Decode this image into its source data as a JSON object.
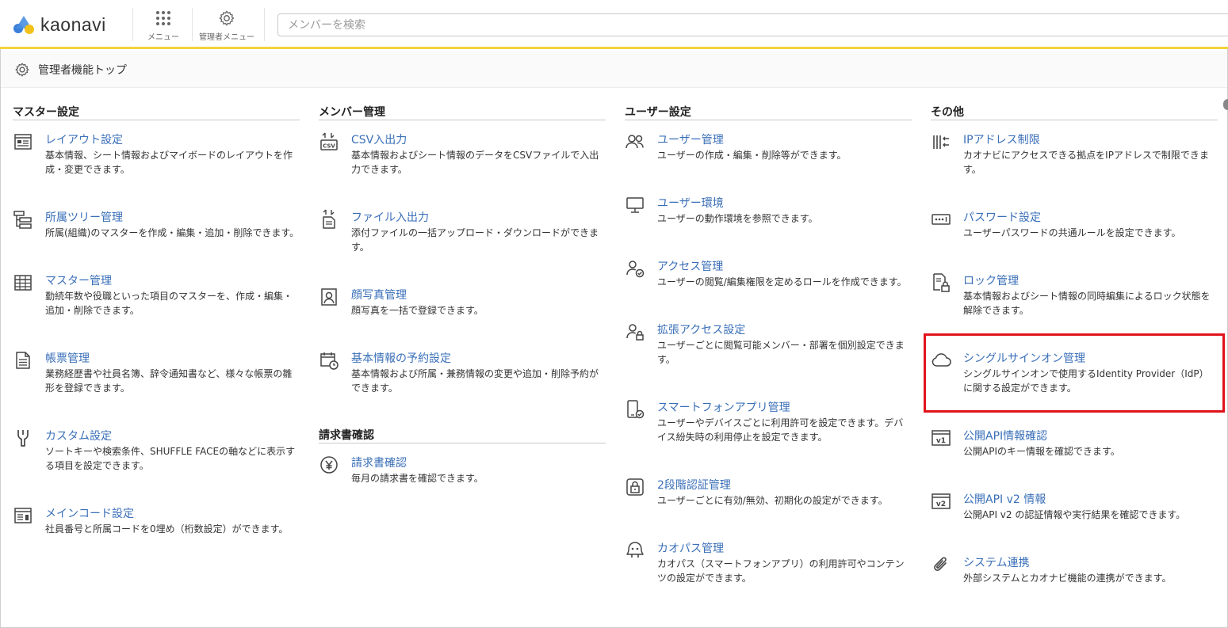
{
  "header": {
    "logo_text": "kaonavi",
    "menu_label": "メニュー",
    "admin_menu_label": "管理者メニュー",
    "search_placeholder": "メンバーを検索"
  },
  "page": {
    "title": "管理者機能トップ"
  },
  "columns": [
    {
      "heading": "マスター設定",
      "items": [
        {
          "label": "レイアウト設定",
          "desc": "基本情報、シート情報およびマイボードのレイアウトを作成・変更できます。",
          "icon": "layout-icon"
        },
        {
          "label": "所属ツリー管理",
          "desc": "所属(組織)のマスターを作成・編集・追加・削除できます。",
          "icon": "tree-icon"
        },
        {
          "label": "マスター管理",
          "desc": "勤続年数や役職といった項目のマスターを、作成・編集・追加・削除できます。",
          "icon": "table-icon"
        },
        {
          "label": "帳票管理",
          "desc": "業務経歴書や社員名簿、辞令通知書など、様々な帳票の雛形を登録できます。",
          "icon": "document-icon"
        },
        {
          "label": "カスタム設定",
          "desc": "ソートキーや検索条件、SHUFFLE FACEの軸などに表示する項目を設定できます。",
          "icon": "wrench-icon"
        },
        {
          "label": "メインコード設定",
          "desc": "社員番号と所属コードを0埋め（桁数設定）ができます。",
          "icon": "code-window-icon"
        }
      ]
    },
    {
      "heading": "メンバー管理",
      "items": [
        {
          "label": "CSV入出力",
          "desc": "基本情報およびシート情報のデータをCSVファイルで入出力できます。",
          "icon": "csv-icon"
        },
        {
          "label": "ファイル入出力",
          "desc": "添付ファイルの一括アップロード・ダウンロードができます。",
          "icon": "file-transfer-icon"
        },
        {
          "label": "顔写真管理",
          "desc": "顔写真を一括で登録できます。",
          "icon": "portrait-icon"
        },
        {
          "label": "基本情報の予約設定",
          "desc": "基本情報および所属・兼務情報の変更や追加・削除予約ができます。",
          "icon": "calendar-clock-icon"
        }
      ],
      "heading2": "請求書確認",
      "items2": [
        {
          "label": "請求書確認",
          "desc": "毎月の請求書を確認できます。",
          "icon": "yen-icon"
        }
      ]
    },
    {
      "heading": "ユーザー設定",
      "items": [
        {
          "label": "ユーザー管理",
          "desc": "ユーザーの作成・編集・削除等ができます。",
          "icon": "users-icon"
        },
        {
          "label": "ユーザー環境",
          "desc": "ユーザーの動作環境を参照できます。",
          "icon": "monitor-icon"
        },
        {
          "label": "アクセス管理",
          "desc": "ユーザーの閲覧/編集権限を定めるロールを作成できます。",
          "icon": "user-check-icon"
        },
        {
          "label": "拡張アクセス設定",
          "desc": "ユーザーごとに閲覧可能メンバー・部署を個別設定できます。",
          "icon": "user-lock-icon"
        },
        {
          "label": "スマートフォンアプリ管理",
          "desc": "ユーザーやデバイスごとに利用許可を設定できます。デバイス紛失時の利用停止を設定できます。",
          "icon": "smartphone-check-icon"
        },
        {
          "label": "2段階認証管理",
          "desc": "ユーザーごとに有効/無効、初期化の設定ができます。",
          "icon": "two-factor-lock-icon"
        },
        {
          "label": "カオパス管理",
          "desc": "カオパス（スマートフォンアプリ）の利用許可やコンテンツの設定ができます。",
          "icon": "kaopass-icon"
        }
      ]
    },
    {
      "heading": "その他",
      "items": [
        {
          "label": "IPアドレス制限",
          "desc": "カオナビにアクセスできる拠点をIPアドレスで制限できます。",
          "icon": "ip-restrict-icon"
        },
        {
          "label": "パスワード設定",
          "desc": "ユーザーパスワードの共通ルールを設定できます。",
          "icon": "password-icon"
        },
        {
          "label": "ロック管理",
          "desc": "基本情報およびシート情報の同時編集によるロック状態を解除できます。",
          "icon": "file-lock-icon"
        },
        {
          "label": "シングルサインオン管理",
          "desc": "シングルサインオンで使用するIdentity Provider（IdP）に関する設定ができます。",
          "icon": "cloud-icon"
        },
        {
          "label": "公開API情報確認",
          "desc": "公開APIのキー情報を確認できます。",
          "icon": "api-v1-icon"
        },
        {
          "label": "公開API v2 情報",
          "desc": "公開API v2 の認証情報や実行結果を確認できます。",
          "icon": "api-v2-icon"
        },
        {
          "label": "システム連携",
          "desc": "外部システムとカオナビ機能の連携ができます。",
          "icon": "paperclip-icon"
        }
      ]
    }
  ],
  "colors": {
    "link": "#3a6fb8",
    "accent_bar": "#f2d43a",
    "highlight": "#e0131b"
  }
}
